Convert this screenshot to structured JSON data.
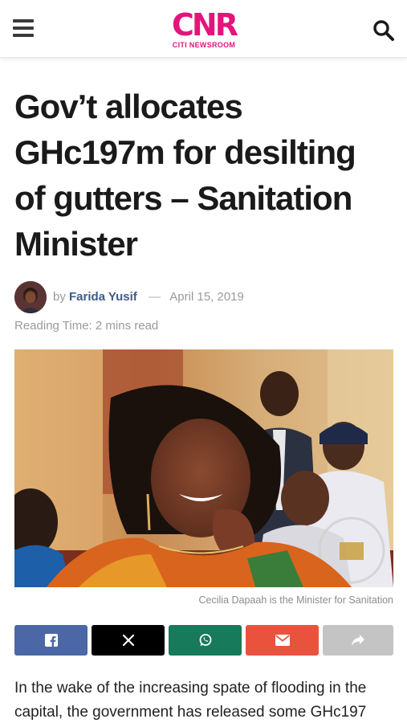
{
  "header": {
    "logo_mark": "CNR",
    "logo_sub": "CITI NEWSROOM",
    "menu_icon": "hamburger-menu-icon",
    "search_icon": "search-icon",
    "brand_color": "#e4147c"
  },
  "article": {
    "headline": "Gov’t allocates GHc197m for desilting of gutters – Sanitation Minister",
    "by_prefix": "by",
    "author": "Farida Yusif",
    "separator": "—",
    "date": "April 15, 2019",
    "reading_time": "Reading Time: 2 mins read",
    "image_caption": "Cecilia Dapaah is the Minister for Sanitation",
    "body": "In the wake of the increasing spate of flooding in the capital, the government has released some GHc197"
  },
  "share": {
    "buttons": [
      {
        "network": "facebook",
        "icon": "facebook-icon",
        "color": "#4b67a6"
      },
      {
        "network": "x",
        "icon": "x-icon",
        "color": "#000000"
      },
      {
        "network": "whatsapp",
        "icon": "whatsapp-icon",
        "color": "#167a5b"
      },
      {
        "network": "email",
        "icon": "email-icon",
        "color": "#e9533d"
      },
      {
        "network": "share",
        "icon": "share-arrow-icon",
        "color": "#c4c4c4"
      }
    ]
  }
}
